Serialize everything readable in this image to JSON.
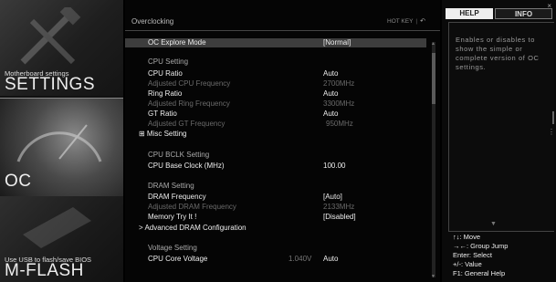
{
  "sidebar": {
    "settings": {
      "small": "Motherboard settings",
      "big": "SETTINGS"
    },
    "oc": {
      "big": "OC"
    },
    "mflash": {
      "small": "Use USB to flash/save BIOS",
      "big": "M-FLASH"
    }
  },
  "main": {
    "title": "Overclocking",
    "hotkey": "HOT KEY",
    "hotkey_sep": "|",
    "back_icon": "↶",
    "rows": [
      {
        "label": "OC Explore Mode",
        "value": "[Normal]"
      },
      {
        "label": "CPU  Setting"
      },
      {
        "label": "CPU Ratio",
        "value": "Auto"
      },
      {
        "label": "Adjusted CPU Frequency",
        "value": "2700MHz"
      },
      {
        "label": "Ring Ratio",
        "value": "Auto"
      },
      {
        "label": "Adjusted Ring Frequency",
        "value": "3300MHz"
      },
      {
        "label": "GT Ratio",
        "value": "Auto"
      },
      {
        "label": "Adjusted GT Frequency",
        "value": "950MHz"
      },
      {
        "label": "⊞ Misc Setting"
      },
      {
        "label": "CPU  BCLK  Setting"
      },
      {
        "label": "CPU Base Clock (MHz)",
        "value": "100.00"
      },
      {
        "label": "DRAM  Setting"
      },
      {
        "label": "DRAM Frequency",
        "value": "[Auto]"
      },
      {
        "label": "Adjusted DRAM Frequency",
        "value": "2133MHz"
      },
      {
        "label": "Memory Try It !",
        "value": "[Disabled]"
      },
      {
        "label": "> Advanced DRAM Configuration"
      },
      {
        "label": "Voltage  Setting"
      },
      {
        "label": "CPU Core Voltage",
        "v1": "1.040V",
        "value": "Auto"
      }
    ]
  },
  "help": {
    "tab_help": "HELP",
    "tab_info": "INFO",
    "close": "×",
    "text": "Enables or disables to show the simple or complete version of OC settings.",
    "keys": [
      "↑↓: Move",
      "→←: Group Jump",
      "Enter: Select",
      "+/-: Value",
      "F1: General Help"
    ]
  },
  "colors": {
    "accent": "#eeeeee",
    "selected_row": "#3d3d3d",
    "dim_text": "#6a6a6a"
  }
}
